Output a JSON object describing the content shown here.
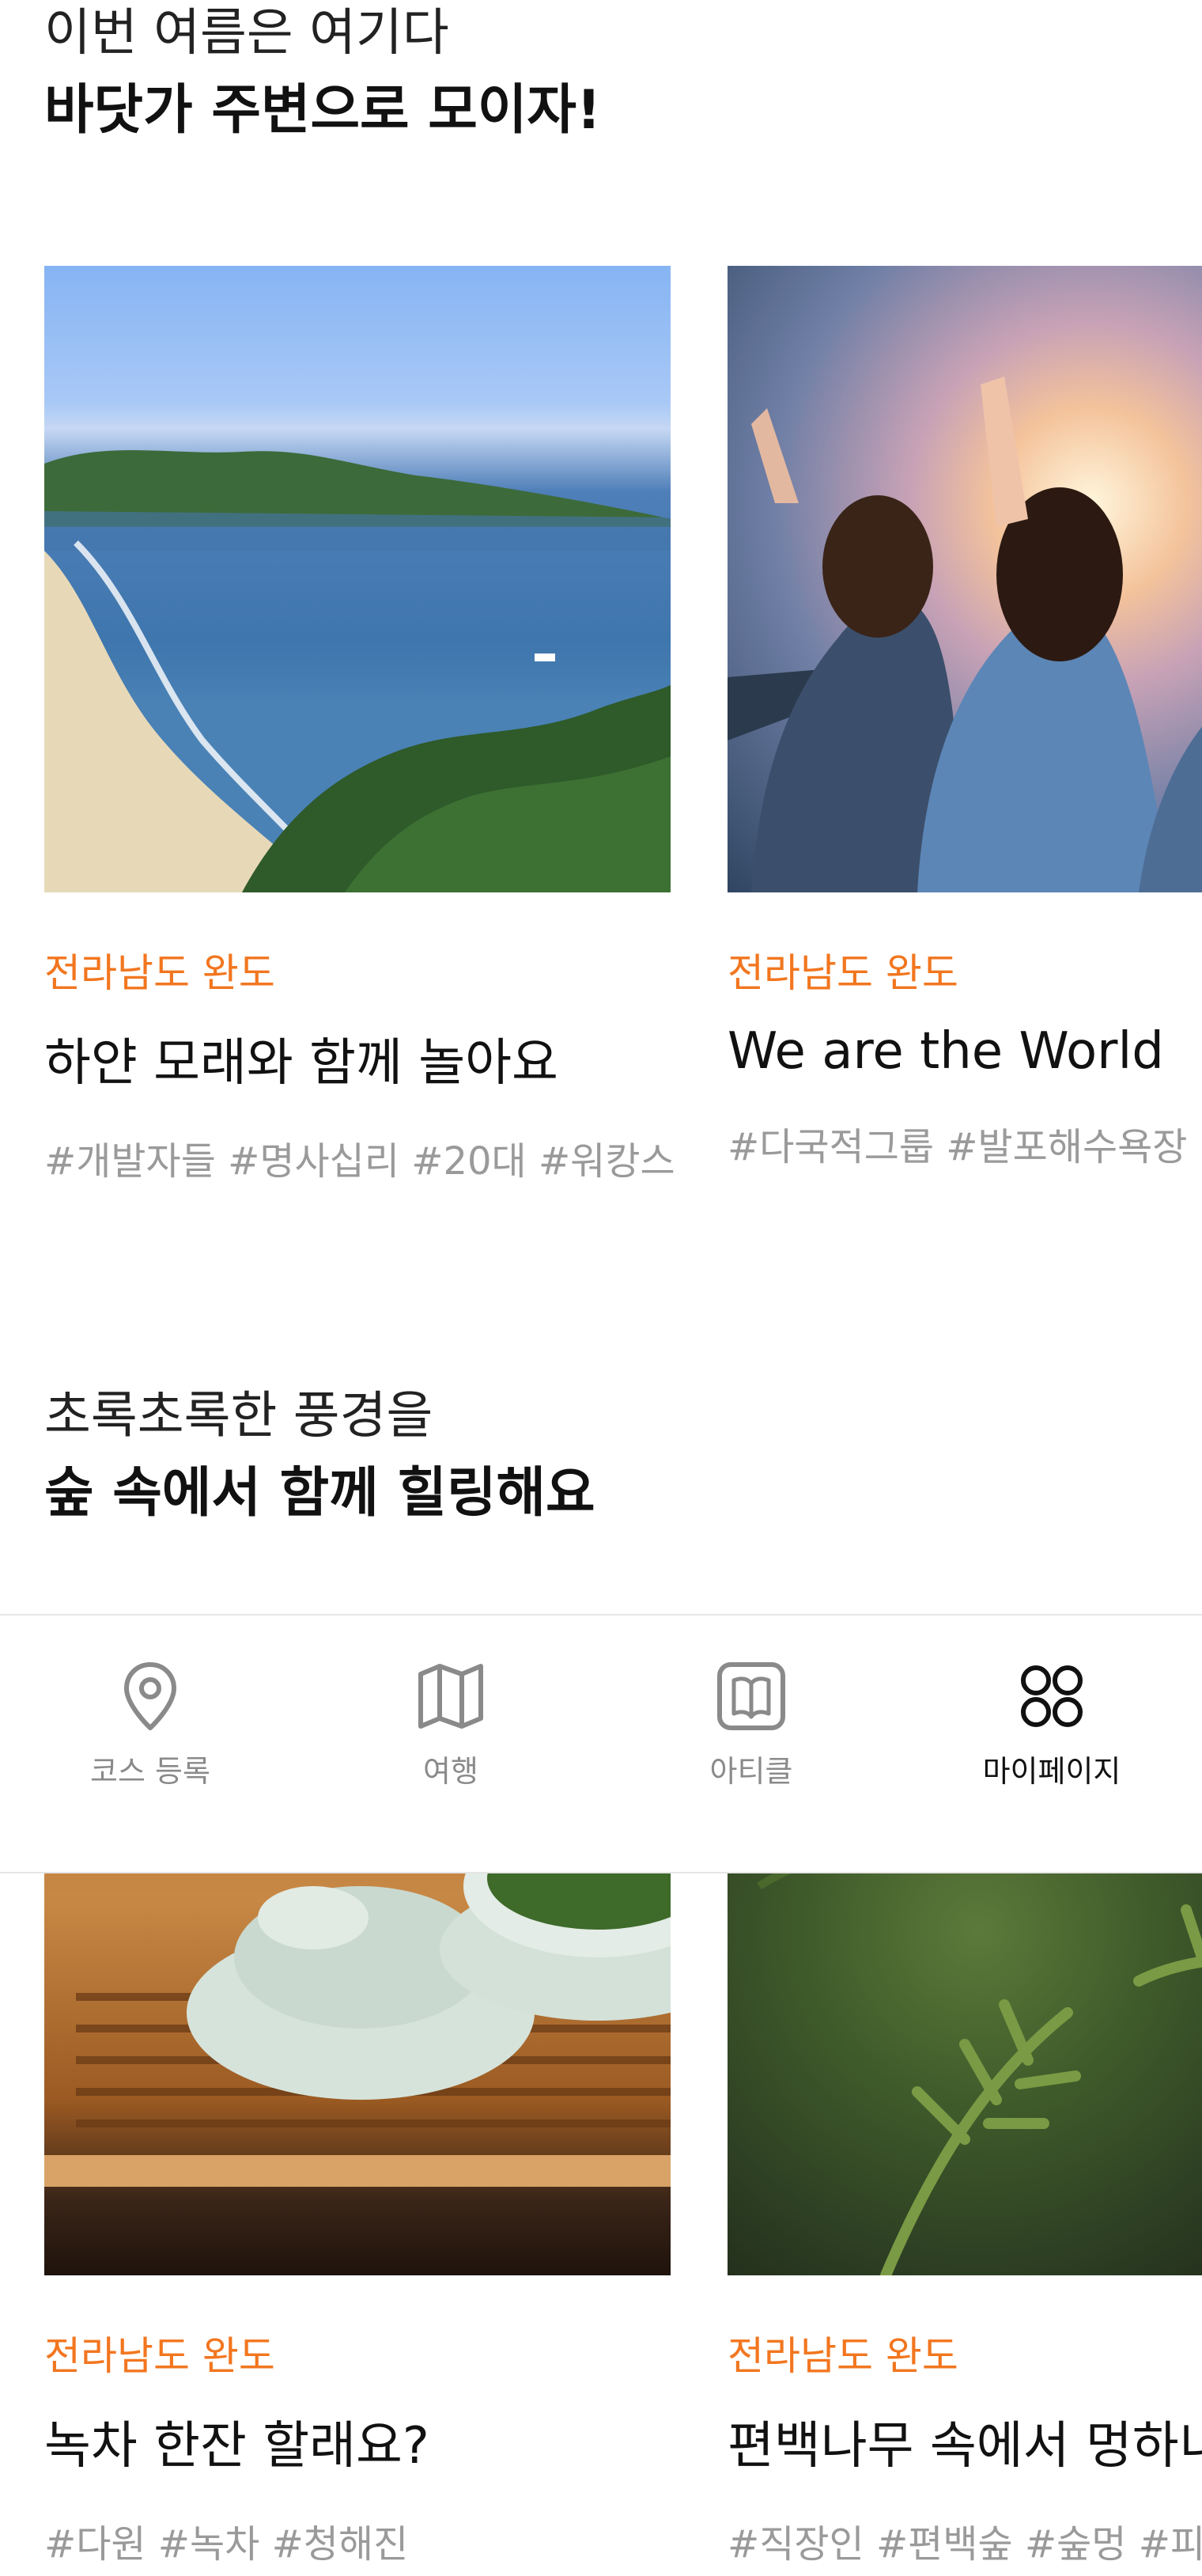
{
  "sections": [
    {
      "subtitle": "이번 여름은 여기다",
      "title": "바닷가 주변으로 모이자!",
      "cards": [
        {
          "region": "전라남도 완도",
          "title": "하얀 모래와 함께 놀아요",
          "tags": "#개발자들 #명사십리 #20대 #워캉스"
        },
        {
          "region": "전라남도 완도",
          "title": "We are the World",
          "tags": "#다국적그룹 #발포해수욕장 #"
        }
      ]
    },
    {
      "subtitle": "초록초록한 풍경을",
      "title": "숲 속에서 함께 힐링해요",
      "cards": [
        {
          "region": "전라남도 완도",
          "title": "녹차 한잔 할래요?",
          "tags": "#다원 #녹차 #청해진"
        },
        {
          "region": "전라남도 완도",
          "title": "편백나무 속에서 멍하니",
          "tags": "#직장인 #편백숲 #숲멍 #피톤"
        }
      ]
    }
  ],
  "tabbar": {
    "tabs": [
      {
        "label": "코스 등록",
        "icon": "map-pin-icon",
        "active": false
      },
      {
        "label": "여행",
        "icon": "map-icon",
        "active": false
      },
      {
        "label": "아티클",
        "icon": "book-icon",
        "active": false
      },
      {
        "label": "마이페이지",
        "icon": "four-circles-icon",
        "active": true
      }
    ]
  },
  "colors": {
    "accent": "#f2761f",
    "tag": "#9a9a9a",
    "tab_inactive": "#8a8a8a",
    "tab_active": "#111111"
  }
}
